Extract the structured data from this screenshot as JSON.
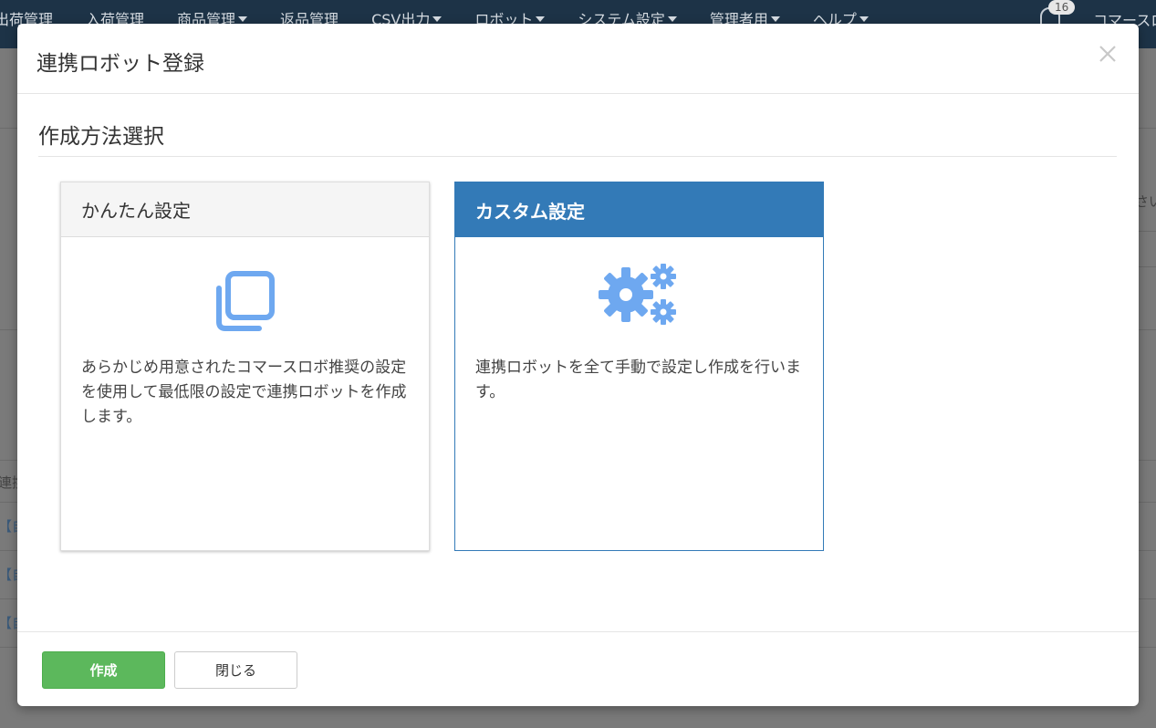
{
  "nav": {
    "items": [
      {
        "label": "出荷管理",
        "dropdown": false
      },
      {
        "label": "入荷管理",
        "dropdown": false
      },
      {
        "label": "商品管理",
        "dropdown": true
      },
      {
        "label": "返品管理",
        "dropdown": false
      },
      {
        "label": "CSV出力",
        "dropdown": true
      },
      {
        "label": "ロボット",
        "dropdown": true
      },
      {
        "label": "システム設定",
        "dropdown": true
      },
      {
        "label": "管理者用",
        "dropdown": true
      },
      {
        "label": "ヘルプ",
        "dropdown": true
      }
    ],
    "notification_count": "16",
    "user_label": "コマースロ"
  },
  "background": {
    "right_partial": "さい",
    "row_label": "連携",
    "row_items": [
      "【自",
      "【自",
      "【自"
    ]
  },
  "modal": {
    "title": "連携ロボット登録",
    "section_title": "作成方法選択",
    "cards": {
      "simple": {
        "title": "かんたん設定",
        "icon": "copy-icon",
        "description": "あらかじめ用意されたコマースロボ推奨の設定を使用して最低限の設定で連携ロボットを作成します。"
      },
      "custom": {
        "title": "カスタム設定",
        "icon": "gears-icon",
        "description": "連携ロボットを全て手動で設定し作成を行います。",
        "selected": true
      }
    },
    "buttons": {
      "create": "作成",
      "close": "閉じる"
    }
  },
  "colors": {
    "primary": "#337ab7",
    "success": "#5cb85c",
    "icon_blue": "#6ea8f0",
    "nav_bg": "#1d3347"
  }
}
